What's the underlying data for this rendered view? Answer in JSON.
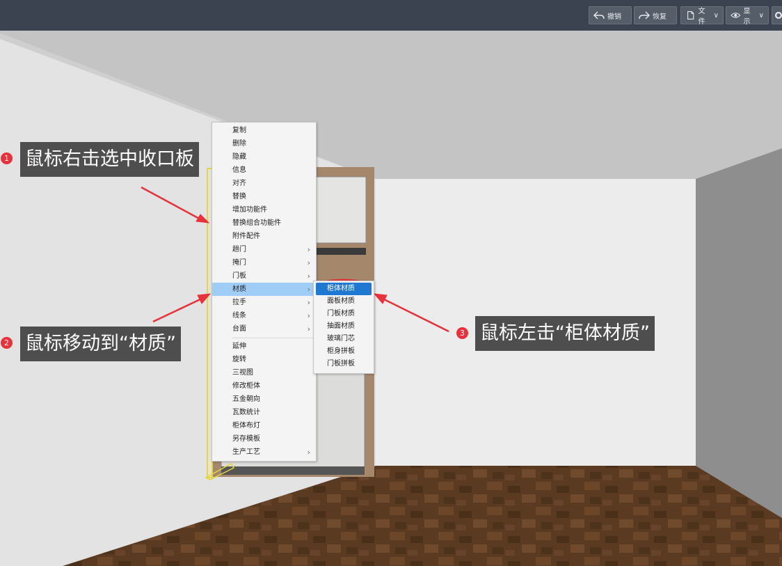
{
  "toolbar": {
    "undo": "撤销",
    "redo": "恢复",
    "file": "文件",
    "display": "显示"
  },
  "context_menu": {
    "items": [
      {
        "label": "复制",
        "has_submenu": false
      },
      {
        "label": "删除",
        "has_submenu": false
      },
      {
        "label": "隐藏",
        "has_submenu": false
      },
      {
        "label": "信息",
        "has_submenu": false
      },
      {
        "label": "对齐",
        "has_submenu": false
      },
      {
        "label": "替换",
        "has_submenu": false
      },
      {
        "label": "增加功能件",
        "has_submenu": false
      },
      {
        "label": "替换组合功能件",
        "has_submenu": false
      },
      {
        "label": "附件配件",
        "has_submenu": false
      },
      {
        "label": "趟门",
        "has_submenu": true
      },
      {
        "label": "掩门",
        "has_submenu": true
      },
      {
        "label": "门板",
        "has_submenu": true
      },
      {
        "label": "材质",
        "has_submenu": true,
        "highlighted": true
      },
      {
        "label": "拉手",
        "has_submenu": true
      },
      {
        "label": "线条",
        "has_submenu": true
      },
      {
        "label": "台面",
        "has_submenu": true
      },
      {
        "label": "延伸",
        "has_submenu": false
      },
      {
        "label": "旋转",
        "has_submenu": false
      },
      {
        "label": "三视图",
        "has_submenu": false
      },
      {
        "label": "修改柜体",
        "has_submenu": false
      },
      {
        "label": "五金朝向",
        "has_submenu": false
      },
      {
        "label": "瓦数统计",
        "has_submenu": false
      },
      {
        "label": "柜体布灯",
        "has_submenu": false
      },
      {
        "label": "另存模板",
        "has_submenu": false
      },
      {
        "label": "生产工艺",
        "has_submenu": true
      }
    ],
    "submenu_arrow": "›"
  },
  "material_submenu": {
    "items": [
      "柜体材质",
      "面板材质",
      "门板材质",
      "抽面材质",
      "玻璃门芯",
      "柜身拼板",
      "门板拼板"
    ],
    "active_index": 0
  },
  "annotations": [
    {
      "badge": "1",
      "text": "鼠标右击选中收口板"
    },
    {
      "badge": "2",
      "text": "鼠标移动到“材质”"
    },
    {
      "badge": "3",
      "text": "鼠标左击“柜体材质”"
    }
  ],
  "colors": {
    "toolbar_bg": "#3b4350",
    "menu_highlight": "#9fcdf6",
    "submenu_active": "#1f78d1",
    "annotation_red": "#e8313a",
    "callout_bg": "#4e4e4e"
  }
}
